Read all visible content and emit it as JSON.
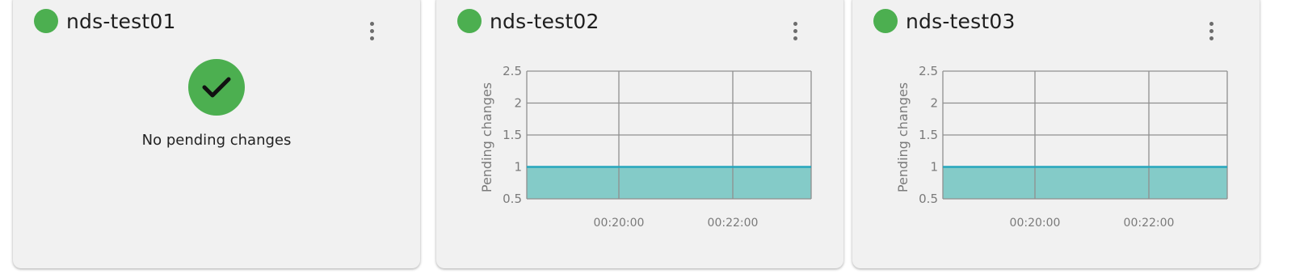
{
  "colors": {
    "status_green": "#4caf50",
    "area_fill": "#84cbc8",
    "area_line": "#26a6bd",
    "grid": "#8f8f8f",
    "axis_text": "#7a7a7a"
  },
  "cards": [
    {
      "title": "nds-test01",
      "status_icon": "online-status-dot",
      "menu_icon": "more-vertical-icon",
      "status_message": "No pending changes",
      "status_message_icon": "checkmark-icon"
    },
    {
      "title": "nds-test02",
      "status_icon": "online-status-dot",
      "menu_icon": "more-vertical-icon",
      "chart_data": {
        "type": "area",
        "ylabel": "Pending changes",
        "xlabel": "",
        "y_ticks": [
          "2.5",
          "2",
          "1.5",
          "1",
          "0.5"
        ],
        "ylim": [
          0.5,
          2.5
        ],
        "x_ticks": [
          "00:20:00",
          "00:22:00"
        ],
        "series": [
          {
            "values": [
              1,
              1,
              1
            ]
          }
        ],
        "grid": true
      }
    },
    {
      "title": "nds-test03",
      "status_icon": "online-status-dot",
      "menu_icon": "more-vertical-icon",
      "chart_data": {
        "type": "area",
        "ylabel": "Pending changes",
        "xlabel": "",
        "y_ticks": [
          "2.5",
          "2",
          "1.5",
          "1",
          "0.5"
        ],
        "ylim": [
          0.5,
          2.5
        ],
        "x_ticks": [
          "00:20:00",
          "00:22:00"
        ],
        "series": [
          {
            "values": [
              1,
              1,
              1
            ]
          }
        ],
        "grid": true
      }
    }
  ]
}
